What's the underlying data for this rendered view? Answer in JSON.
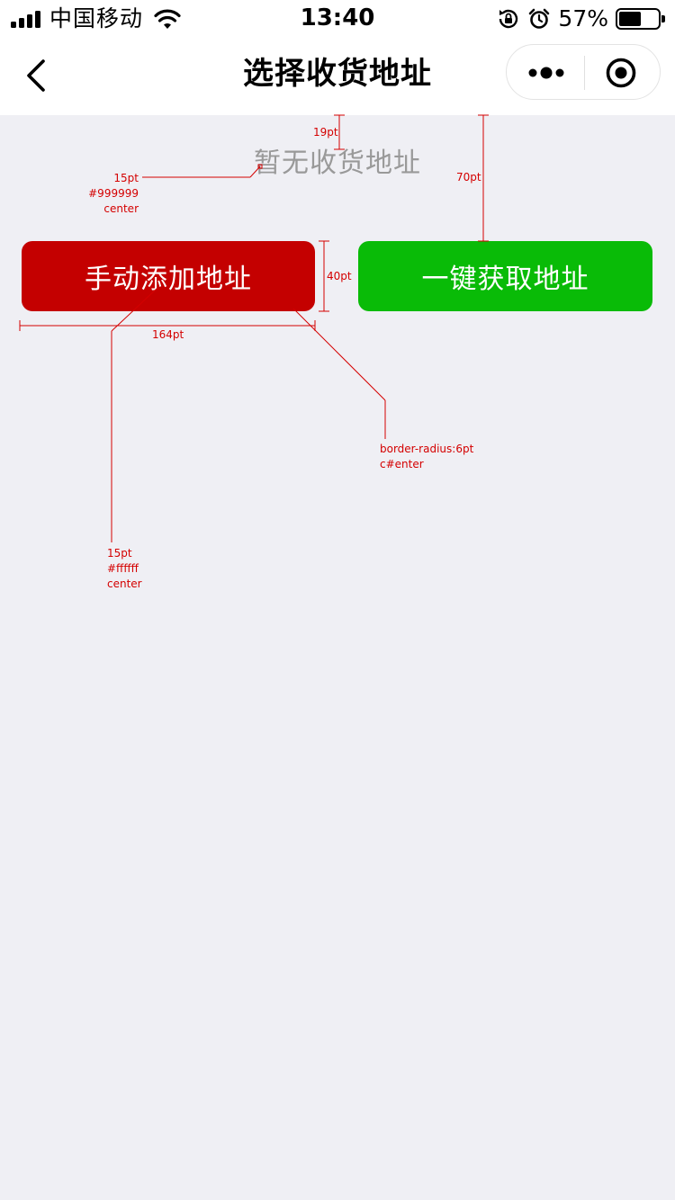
{
  "status_bar": {
    "carrier": "中国移动",
    "time": "13:40",
    "battery_percent": "57%",
    "battery_level": 0.57,
    "icons": [
      "signal-icon",
      "wifi-icon",
      "rotation-lock-icon",
      "alarm-icon",
      "battery-icon"
    ]
  },
  "nav": {
    "title": "选择收货地址",
    "back_icon": "chevron-left-icon",
    "capsule_icons": [
      "more-dots-icon",
      "target-icon"
    ]
  },
  "content": {
    "empty_text": "暂无收货地址",
    "manual_button_label": "手动添加地址",
    "wechat_button_label": "一键获取地址"
  },
  "colors": {
    "background": "#efeff4",
    "empty_text": "#999999",
    "manual_button": "#c40000",
    "wechat_button": "#09bb07",
    "annotation": "#d40000"
  },
  "annotations": {
    "top_gap": "19pt",
    "empty_font_size": "15pt",
    "empty_color": "#999999",
    "empty_align": "center",
    "button_gap": "70pt",
    "button_height": "40pt",
    "button_width": "164pt",
    "button_radius": "border-radius:6pt",
    "button_align": "c#enter",
    "button_font_size": "15pt",
    "button_color": "#ffffff",
    "button_text_align": "center"
  }
}
